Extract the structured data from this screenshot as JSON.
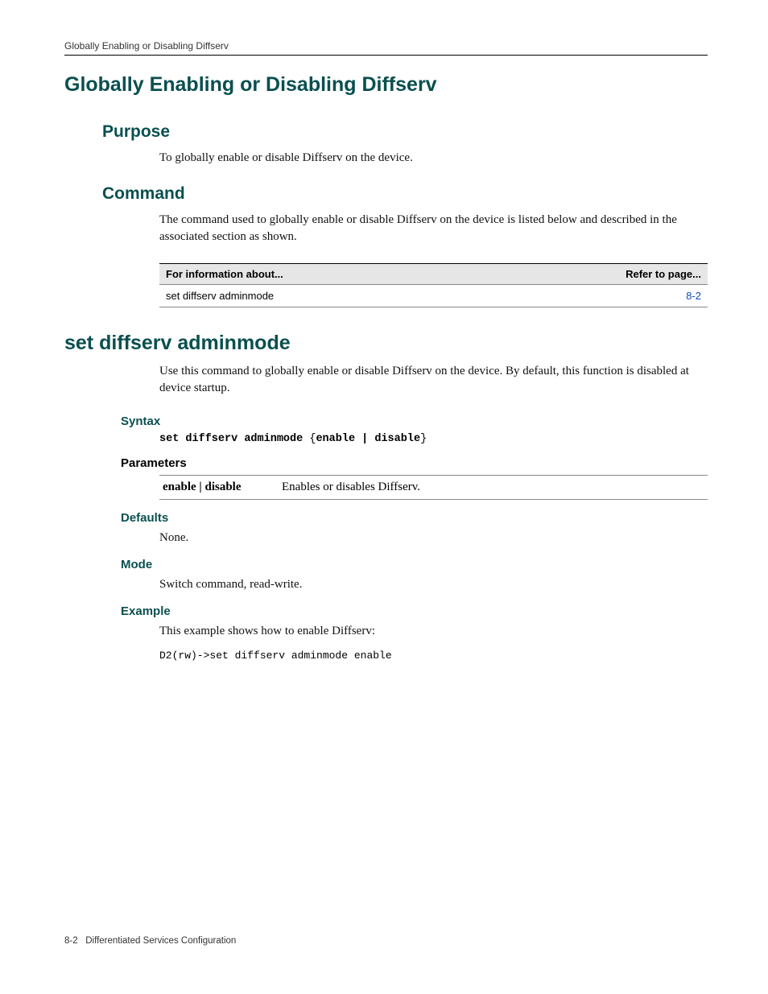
{
  "header": {
    "running": "Globally Enabling or Disabling Diffserv"
  },
  "section": {
    "title": "Globally Enabling or Disabling Diffserv",
    "purpose": {
      "heading": "Purpose",
      "text": "To globally enable or disable Diffserv on the device."
    },
    "command": {
      "heading": "Command",
      "text": "The command used to globally enable or disable Diffserv on the device is listed below and described in the associated section as shown.",
      "table": {
        "col1": "For information about...",
        "col2": "Refer to page...",
        "row1_c1": "set diffserv adminmode",
        "row1_c2": "8-2"
      }
    }
  },
  "cmd": {
    "title": "set diffserv adminmode",
    "intro": "Use this command to globally enable or disable Diffserv on the device. By default, this function is disabled at device startup.",
    "syntax": {
      "heading": "Syntax",
      "cmd": "set diffserv adminmode",
      "opt": "enable | disable"
    },
    "parameters": {
      "heading": "Parameters",
      "row1_k": "enable | disable",
      "row1_v": "Enables or disables Diffserv."
    },
    "defaults": {
      "heading": "Defaults",
      "text": "None."
    },
    "mode": {
      "heading": "Mode",
      "text": "Switch command, read-write."
    },
    "example": {
      "heading": "Example",
      "intro": "This example shows how to enable Diffserv:",
      "code": "D2(rw)->set diffserv adminmode enable"
    }
  },
  "footer": {
    "page": "8-2",
    "chapter": "Differentiated Services Configuration"
  }
}
